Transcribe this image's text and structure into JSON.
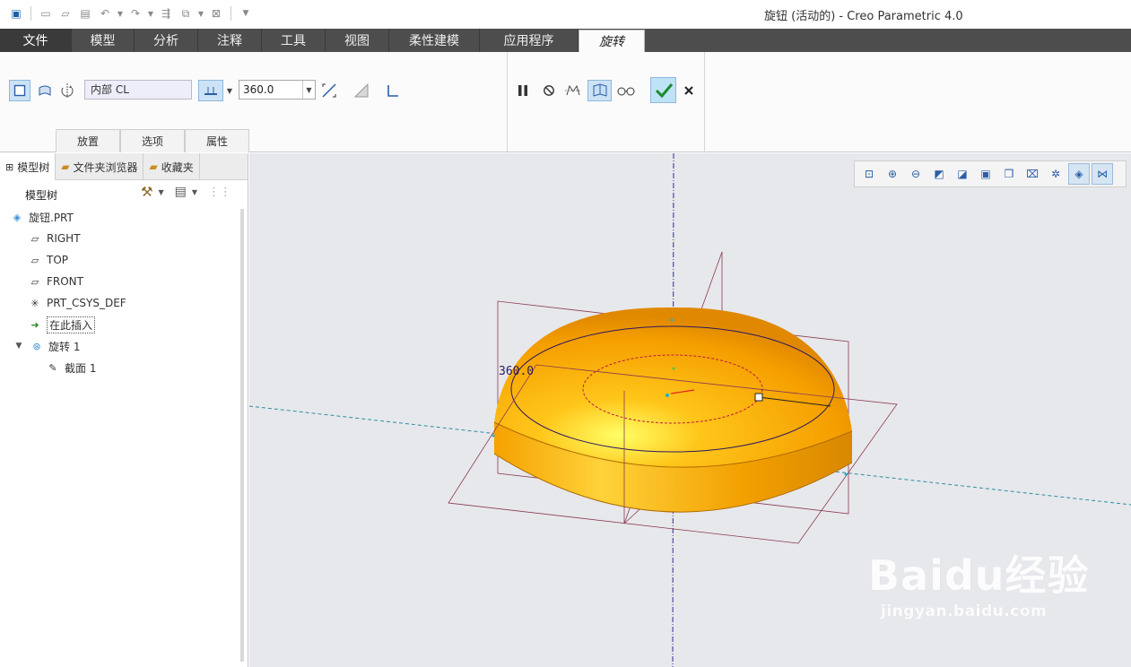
{
  "window": {
    "title": "旋钮 (活动的) - Creo Parametric 4.0"
  },
  "ribbon_tabs": [
    {
      "label": "文件"
    },
    {
      "label": "模型"
    },
    {
      "label": "分析"
    },
    {
      "label": "注释"
    },
    {
      "label": "工具"
    },
    {
      "label": "视图"
    },
    {
      "label": "柔性建模"
    },
    {
      "label": "应用程序"
    },
    {
      "label": "旋转"
    }
  ],
  "revolve": {
    "axis_reference": "内部 CL",
    "angle_value": "360.0",
    "subtabs": [
      {
        "label": "放置"
      },
      {
        "label": "选项"
      },
      {
        "label": "属性"
      }
    ]
  },
  "left_panel": {
    "tabs": [
      {
        "label": "模型树"
      },
      {
        "label": "文件夹浏览器"
      },
      {
        "label": "收藏夹"
      }
    ],
    "tree_header": "模型树",
    "nodes": [
      {
        "label": "旋钮.PRT"
      },
      {
        "label": "RIGHT"
      },
      {
        "label": "TOP"
      },
      {
        "label": "FRONT"
      },
      {
        "label": "PRT_CSYS_DEF"
      },
      {
        "label": "在此插入"
      },
      {
        "label": "旋转 1"
      },
      {
        "label": "截面 1"
      }
    ]
  },
  "viewport": {
    "dimension_label": "360.0",
    "watermark": {
      "line1": "Baidu经验",
      "line2": "jingyan.baidu.com"
    }
  },
  "colors": {
    "model": "#f5a30a",
    "ribbon_dark": "#4d4d4d",
    "viewport_bg": "#e7e8ec"
  }
}
